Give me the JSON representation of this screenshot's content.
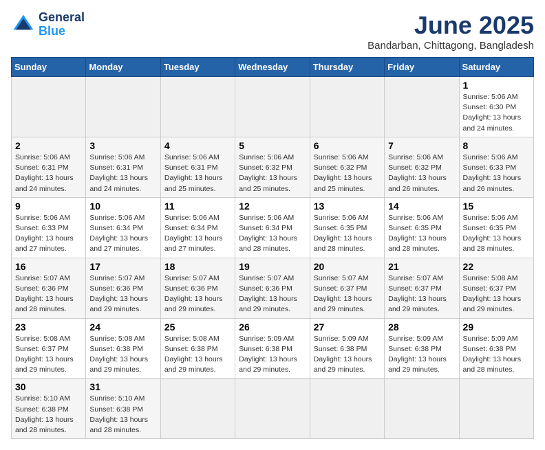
{
  "header": {
    "logo_line1": "General",
    "logo_line2": "Blue",
    "title": "June 2025",
    "subtitle": "Bandarban, Chittagong, Bangladesh"
  },
  "calendar": {
    "days_of_week": [
      "Sunday",
      "Monday",
      "Tuesday",
      "Wednesday",
      "Thursday",
      "Friday",
      "Saturday"
    ],
    "weeks": [
      [
        {
          "day": "",
          "info": ""
        },
        {
          "day": "",
          "info": ""
        },
        {
          "day": "",
          "info": ""
        },
        {
          "day": "",
          "info": ""
        },
        {
          "day": "",
          "info": ""
        },
        {
          "day": "",
          "info": ""
        },
        {
          "day": "1",
          "info": "Sunrise: 5:06 AM\nSunset: 6:30 PM\nDaylight: 13 hours\nand 24 minutes."
        }
      ],
      [
        {
          "day": "2",
          "info": "Sunrise: 5:06 AM\nSunset: 6:31 PM\nDaylight: 13 hours\nand 24 minutes."
        },
        {
          "day": "3",
          "info": "Sunrise: 5:06 AM\nSunset: 6:31 PM\nDaylight: 13 hours\nand 24 minutes."
        },
        {
          "day": "4",
          "info": "Sunrise: 5:06 AM\nSunset: 6:31 PM\nDaylight: 13 hours\nand 25 minutes."
        },
        {
          "day": "5",
          "info": "Sunrise: 5:06 AM\nSunset: 6:32 PM\nDaylight: 13 hours\nand 25 minutes."
        },
        {
          "day": "6",
          "info": "Sunrise: 5:06 AM\nSunset: 6:32 PM\nDaylight: 13 hours\nand 25 minutes."
        },
        {
          "day": "7",
          "info": "Sunrise: 5:06 AM\nSunset: 6:32 PM\nDaylight: 13 hours\nand 26 minutes."
        },
        {
          "day": "8",
          "info": "Sunrise: 5:06 AM\nSunset: 6:33 PM\nDaylight: 13 hours\nand 26 minutes."
        }
      ],
      [
        {
          "day": "9",
          "info": "Sunrise: 5:06 AM\nSunset: 6:33 PM\nDaylight: 13 hours\nand 27 minutes."
        },
        {
          "day": "10",
          "info": "Sunrise: 5:06 AM\nSunset: 6:34 PM\nDaylight: 13 hours\nand 27 minutes."
        },
        {
          "day": "11",
          "info": "Sunrise: 5:06 AM\nSunset: 6:34 PM\nDaylight: 13 hours\nand 27 minutes."
        },
        {
          "day": "12",
          "info": "Sunrise: 5:06 AM\nSunset: 6:34 PM\nDaylight: 13 hours\nand 28 minutes."
        },
        {
          "day": "13",
          "info": "Sunrise: 5:06 AM\nSunset: 6:35 PM\nDaylight: 13 hours\nand 28 minutes."
        },
        {
          "day": "14",
          "info": "Sunrise: 5:06 AM\nSunset: 6:35 PM\nDaylight: 13 hours\nand 28 minutes."
        },
        {
          "day": "15",
          "info": "Sunrise: 5:06 AM\nSunset: 6:35 PM\nDaylight: 13 hours\nand 28 minutes."
        }
      ],
      [
        {
          "day": "16",
          "info": "Sunrise: 5:07 AM\nSunset: 6:36 PM\nDaylight: 13 hours\nand 28 minutes."
        },
        {
          "day": "17",
          "info": "Sunrise: 5:07 AM\nSunset: 6:36 PM\nDaylight: 13 hours\nand 29 minutes."
        },
        {
          "day": "18",
          "info": "Sunrise: 5:07 AM\nSunset: 6:36 PM\nDaylight: 13 hours\nand 29 minutes."
        },
        {
          "day": "19",
          "info": "Sunrise: 5:07 AM\nSunset: 6:36 PM\nDaylight: 13 hours\nand 29 minutes."
        },
        {
          "day": "20",
          "info": "Sunrise: 5:07 AM\nSunset: 6:37 PM\nDaylight: 13 hours\nand 29 minutes."
        },
        {
          "day": "21",
          "info": "Sunrise: 5:07 AM\nSunset: 6:37 PM\nDaylight: 13 hours\nand 29 minutes."
        },
        {
          "day": "22",
          "info": "Sunrise: 5:08 AM\nSunset: 6:37 PM\nDaylight: 13 hours\nand 29 minutes."
        }
      ],
      [
        {
          "day": "23",
          "info": "Sunrise: 5:08 AM\nSunset: 6:37 PM\nDaylight: 13 hours\nand 29 minutes."
        },
        {
          "day": "24",
          "info": "Sunrise: 5:08 AM\nSunset: 6:38 PM\nDaylight: 13 hours\nand 29 minutes."
        },
        {
          "day": "25",
          "info": "Sunrise: 5:08 AM\nSunset: 6:38 PM\nDaylight: 13 hours\nand 29 minutes."
        },
        {
          "day": "26",
          "info": "Sunrise: 5:09 AM\nSunset: 6:38 PM\nDaylight: 13 hours\nand 29 minutes."
        },
        {
          "day": "27",
          "info": "Sunrise: 5:09 AM\nSunset: 6:38 PM\nDaylight: 13 hours\nand 29 minutes."
        },
        {
          "day": "28",
          "info": "Sunrise: 5:09 AM\nSunset: 6:38 PM\nDaylight: 13 hours\nand 29 minutes."
        },
        {
          "day": "29",
          "info": "Sunrise: 5:09 AM\nSunset: 6:38 PM\nDaylight: 13 hours\nand 28 minutes."
        }
      ],
      [
        {
          "day": "30",
          "info": "Sunrise: 5:10 AM\nSunset: 6:38 PM\nDaylight: 13 hours\nand 28 minutes."
        },
        {
          "day": "31",
          "info": "Sunrise: 5:10 AM\nSunset: 6:38 PM\nDaylight: 13 hours\nand 28 minutes."
        },
        {
          "day": "",
          "info": ""
        },
        {
          "day": "",
          "info": ""
        },
        {
          "day": "",
          "info": ""
        },
        {
          "day": "",
          "info": ""
        },
        {
          "day": "",
          "info": ""
        }
      ]
    ]
  }
}
